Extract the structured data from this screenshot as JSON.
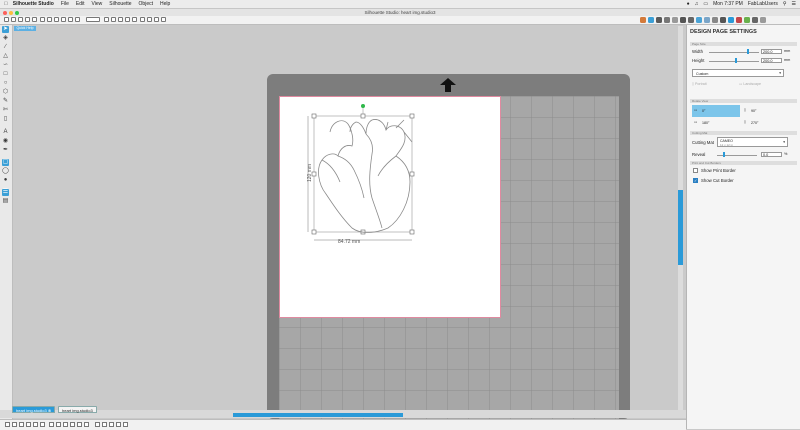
{
  "menubar": {
    "app": "Silhouette Studio",
    "items": [
      "File",
      "Edit",
      "View",
      "Silhouette",
      "Object",
      "Help"
    ],
    "clock": "Mon 7:37 PM",
    "user": "FabLabUsers"
  },
  "window": {
    "title": "Silhouette Studio: heart img.studio3"
  },
  "quick_help": "Quick Help",
  "canvas": {
    "width_dim": "84.72 mm",
    "height_dim": "120 mm"
  },
  "tabs": [
    {
      "label": "heart img.studio3",
      "active": true
    },
    {
      "label": "heart img.studio3",
      "active": false
    }
  ],
  "panel": {
    "title": "DESIGN PAGE SETTINGS",
    "sec_page_size": "Page Size",
    "width_label": "Width",
    "width_value": "200.0",
    "width_unit": "mm",
    "height_label": "Height",
    "height_value": "200.0",
    "height_unit": "mm",
    "page_preset": "Custom",
    "portrait": "Portrait",
    "landscape": "Landscape",
    "sec_rotate": "Rotate View",
    "rot_0": "0°",
    "rot_90": "90°",
    "rot_180": "180°",
    "rot_270": "270°",
    "sec_cutting_mat": "Cutting Mat",
    "cutting_mat_label": "Cutting Mat",
    "cutting_mat_value": "CAMEO",
    "cutting_mat_sub": "12 x 12 in",
    "reveal_label": "Reveal",
    "reveal_value": "0.0",
    "reveal_unit": "%",
    "sec_borders": "Print and Cut Borders",
    "show_print_border": "Show Print Border",
    "show_print_border_checked": false,
    "show_cut_border": "Show Cut Border",
    "show_cut_border_checked": true
  },
  "colors": {
    "accent": "#2a9ad8",
    "mat": "#7d7d7d",
    "grid": "#a7a7a7",
    "page_border": "#e08aa0",
    "selection": "#2fb84a"
  }
}
